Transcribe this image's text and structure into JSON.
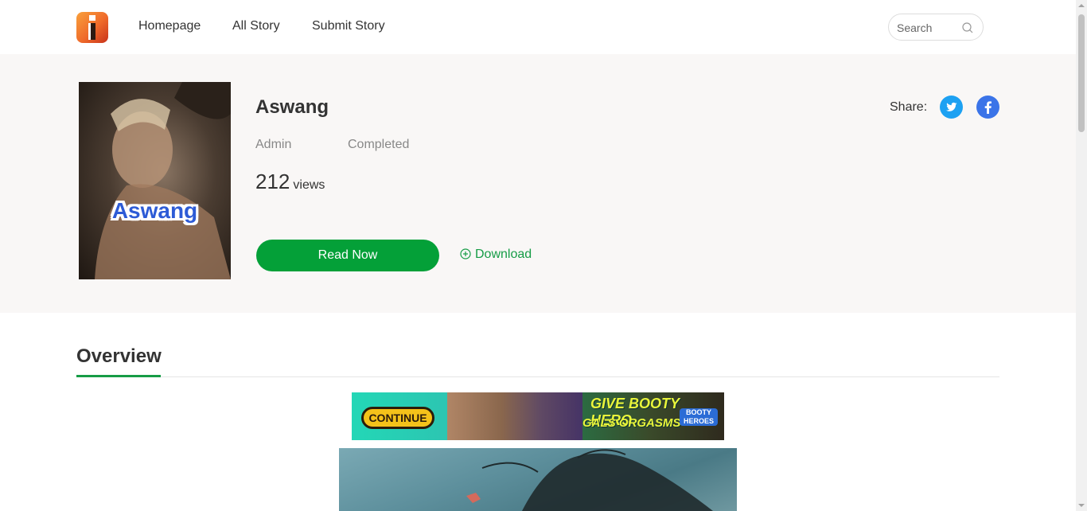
{
  "header": {
    "logo_icon": "site-logo-icon",
    "nav": [
      {
        "label": "Homepage"
      },
      {
        "label": "All Story"
      },
      {
        "label": "Submit Story"
      }
    ],
    "search": {
      "placeholder": "Search",
      "value": "",
      "icon": "search-icon"
    }
  },
  "book": {
    "cover_title": "Aswang",
    "title": "Aswang",
    "author": "Admin",
    "status": "Completed",
    "views_count": "212",
    "views_unit": "views",
    "read_button": "Read Now",
    "download_label": "Download",
    "download_icon": "plus-circle-icon"
  },
  "share": {
    "label": "Share:",
    "buttons": [
      {
        "icon": "twitter-icon",
        "color": "#1da1f2"
      },
      {
        "icon": "facebook-icon",
        "color": "#3b74e8"
      }
    ]
  },
  "overview": {
    "heading": "Overview",
    "accent_color": "#169c46"
  },
  "ad": {
    "button": "CONTINUE",
    "line1": "GIVE BOOTY HERO",
    "line2": "GALS ORGASMS",
    "brand": "BOOTY HEROES"
  },
  "colors": {
    "primary_green": "#04a038",
    "hero_bg": "#f9f7f6"
  }
}
